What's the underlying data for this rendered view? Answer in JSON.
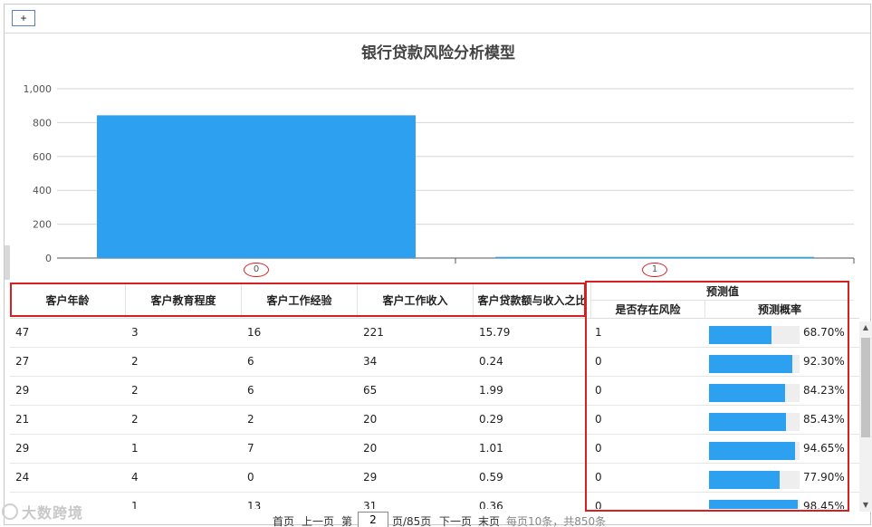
{
  "toolbar": {
    "add_label": "+"
  },
  "chart_data": {
    "type": "bar",
    "title": "银行贷款风险分析模型",
    "categories": [
      "0",
      "1"
    ],
    "values": [
      843,
      7
    ],
    "ylim": [
      0,
      1000
    ],
    "yticks": [
      "0",
      "200",
      "400",
      "600",
      "800",
      "1,000"
    ],
    "grid": true,
    "color": "#2ea0f0"
  },
  "table": {
    "columns": [
      "客户年龄",
      "客户教育程度",
      "客户工作经验",
      "客户工作收入",
      "客户贷款额与收入之比"
    ],
    "group_header": "预测值",
    "sub_columns": [
      "是否存在风险",
      "预测概率"
    ],
    "rows": [
      {
        "age": "47",
        "edu": "3",
        "exp": "16",
        "income": "221",
        "ratio": "15.79",
        "risk": "1",
        "prob": 0.687,
        "prob_label": "68.70%"
      },
      {
        "age": "27",
        "edu": "2",
        "exp": "6",
        "income": "34",
        "ratio": "0.24",
        "risk": "0",
        "prob": 0.923,
        "prob_label": "92.30%"
      },
      {
        "age": "29",
        "edu": "2",
        "exp": "6",
        "income": "65",
        "ratio": "1.99",
        "risk": "0",
        "prob": 0.8423,
        "prob_label": "84.23%"
      },
      {
        "age": "21",
        "edu": "2",
        "exp": "2",
        "income": "20",
        "ratio": "0.29",
        "risk": "0",
        "prob": 0.8543,
        "prob_label": "85.43%"
      },
      {
        "age": "29",
        "edu": "1",
        "exp": "7",
        "income": "20",
        "ratio": "1.01",
        "risk": "0",
        "prob": 0.9465,
        "prob_label": "94.65%"
      },
      {
        "age": "24",
        "edu": "4",
        "exp": "0",
        "income": "29",
        "ratio": "0.59",
        "risk": "0",
        "prob": 0.779,
        "prob_label": "77.90%"
      },
      {
        "age": "",
        "edu": "1",
        "exp": "13",
        "income": "31",
        "ratio": "0.36",
        "risk": "0",
        "prob": 0.9845,
        "prob_label": "98.45%"
      }
    ]
  },
  "pager": {
    "first": "首页",
    "prev": "上一页",
    "page_prefix": "第",
    "page_value": "2",
    "page_suffix": "页/85页",
    "next": "下一页",
    "last": "末页",
    "info": "每页10条，共850条"
  },
  "watermark": "大数跨境"
}
